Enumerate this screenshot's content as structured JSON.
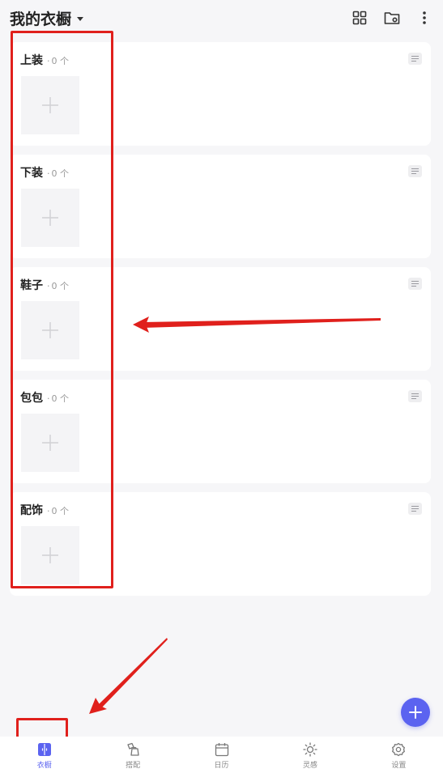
{
  "header": {
    "title": "我的衣橱",
    "actions": [
      {
        "icon": "grid-view-icon"
      },
      {
        "icon": "folder-settings-icon"
      },
      {
        "icon": "more-vertical-icon"
      }
    ]
  },
  "categories": [
    {
      "name": "上装",
      "count": "0 个"
    },
    {
      "name": "下装",
      "count": "0 个"
    },
    {
      "name": "鞋子",
      "count": "0 个"
    },
    {
      "name": "包包",
      "count": "0 个"
    },
    {
      "name": "配饰",
      "count": "0 个"
    }
  ],
  "count_separator": "·",
  "fab": {
    "icon": "plus-icon"
  },
  "bottom_nav": [
    {
      "label": "衣橱",
      "icon": "wardrobe-icon",
      "active": true
    },
    {
      "label": "搭配",
      "icon": "outfit-icon",
      "active": false
    },
    {
      "label": "日历",
      "icon": "calendar-icon",
      "active": false
    },
    {
      "label": "灵感",
      "icon": "inspiration-icon",
      "active": false
    },
    {
      "label": "设置",
      "icon": "settings-icon",
      "active": false
    }
  ],
  "colors": {
    "accent": "#5b63f0",
    "annotation": "#e0201c",
    "background": "#f6f6f8"
  }
}
